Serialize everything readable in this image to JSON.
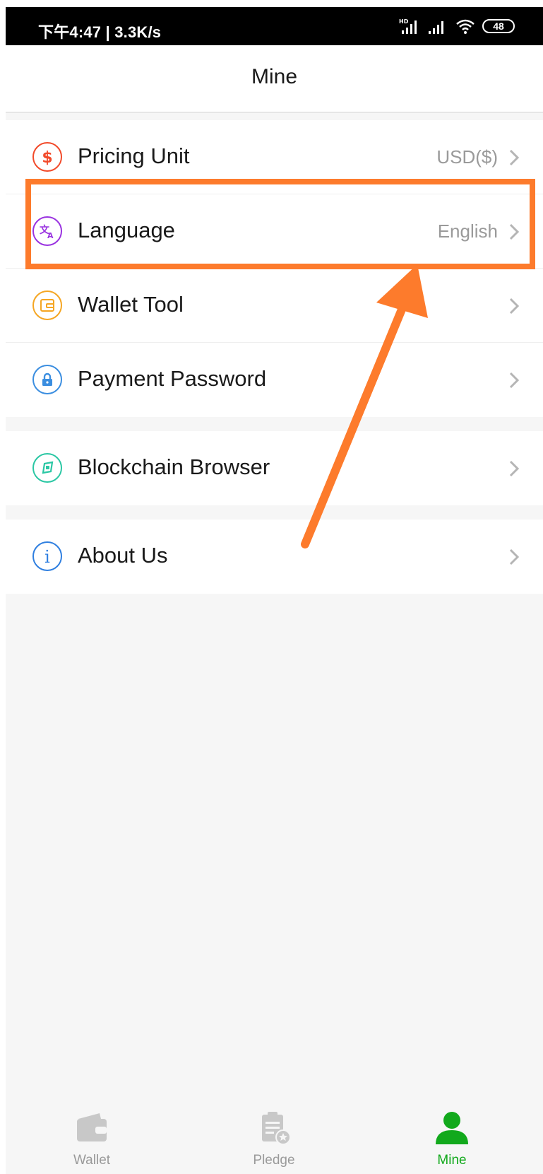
{
  "status_bar": {
    "time": "下午4:47 | 3.3K/s",
    "battery": "48"
  },
  "header": {
    "title": "Mine"
  },
  "groups": [
    {
      "items": [
        {
          "label": "Pricing Unit",
          "value": "USD($)",
          "icon": "dollar-icon",
          "color": "#f24a2a"
        },
        {
          "label": "Language",
          "value": "English",
          "icon": "translate-icon",
          "color": "#9a33e0"
        },
        {
          "label": "Wallet Tool",
          "value": "",
          "icon": "wallet-tool-icon",
          "color": "#f5a623"
        },
        {
          "label": "Payment Password",
          "value": "",
          "icon": "lock-icon",
          "color": "#3b8ee0"
        }
      ]
    },
    {
      "items": [
        {
          "label": "Blockchain Browser",
          "value": "",
          "icon": "compass-icon",
          "color": "#2bc7a4"
        }
      ]
    },
    {
      "items": [
        {
          "label": "About Us",
          "value": "",
          "icon": "info-icon",
          "color": "#2f7fe0"
        }
      ]
    }
  ],
  "annotation": {
    "highlight_color": "#fd7b2c"
  },
  "tabbar": {
    "tabs": [
      {
        "label": "Wallet",
        "icon": "wallet-icon",
        "active": false
      },
      {
        "label": "Pledge",
        "icon": "pledge-icon",
        "active": false
      },
      {
        "label": "Mine",
        "icon": "person-icon",
        "active": true
      }
    ],
    "active_color": "#12a91c",
    "inactive_color": "#c8c8c8"
  }
}
